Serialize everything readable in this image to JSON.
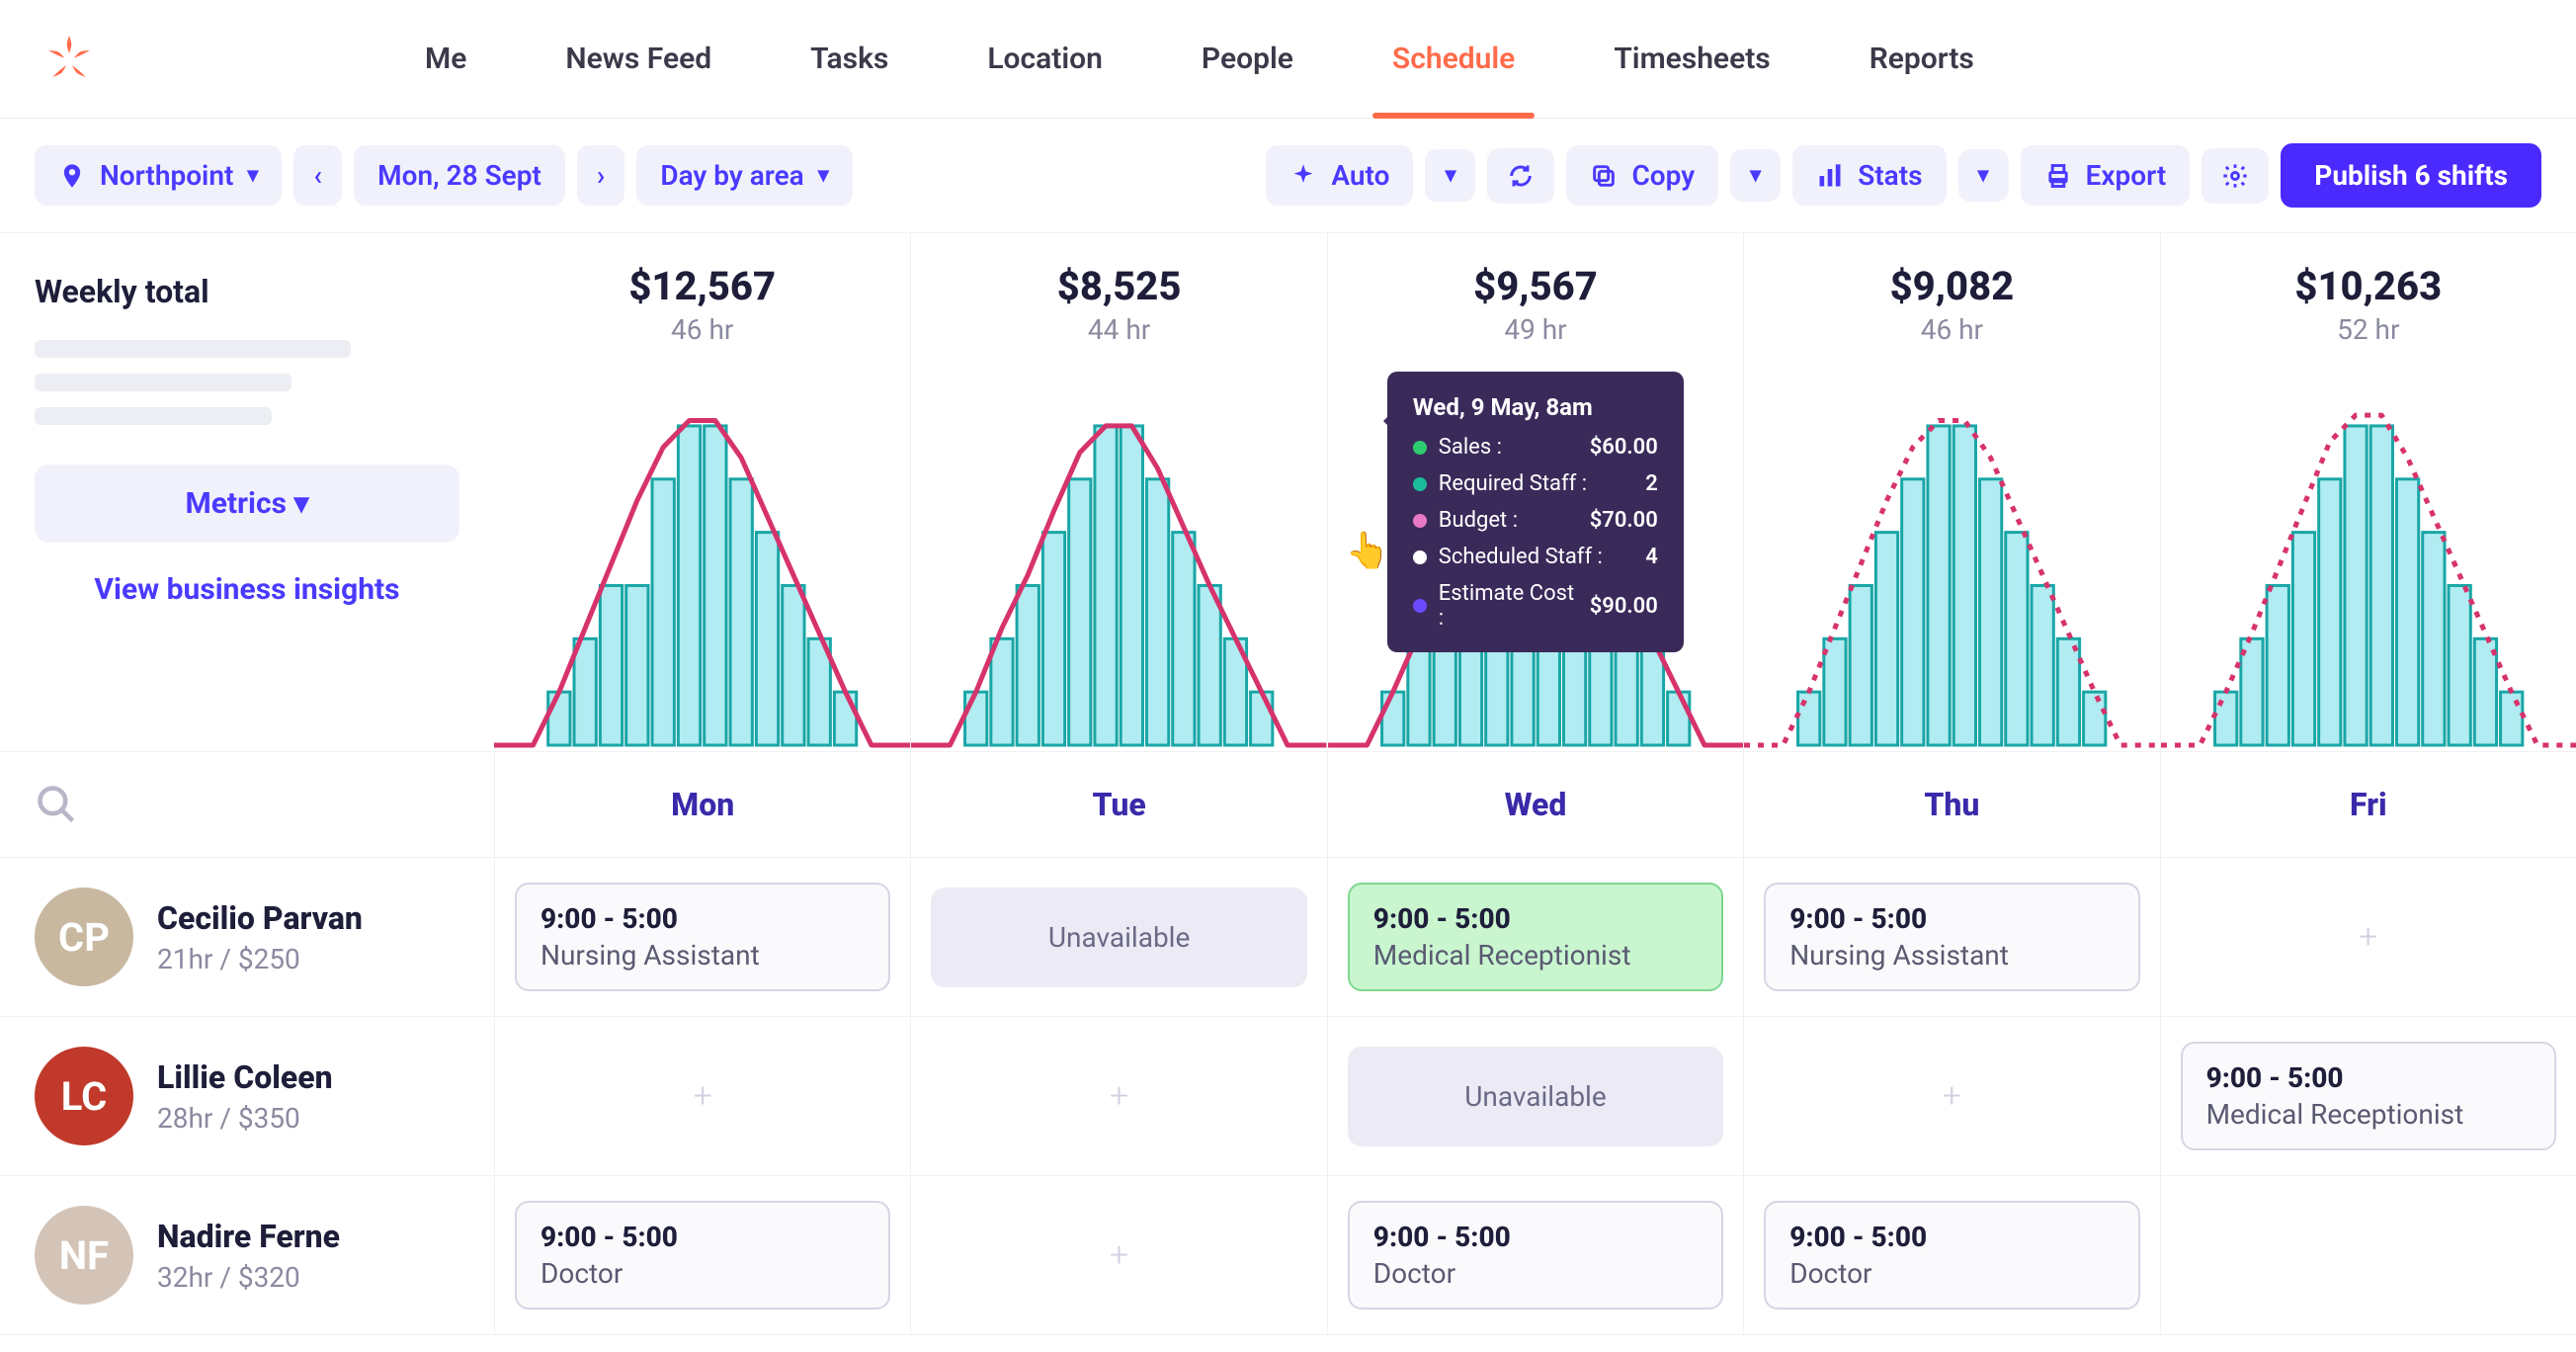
{
  "nav": {
    "items": [
      "Me",
      "News Feed",
      "Tasks",
      "Location",
      "People",
      "Schedule",
      "Timesheets",
      "Reports"
    ],
    "active": "Schedule"
  },
  "toolbar": {
    "location": "Northpoint",
    "date": "Mon, 28 Sept",
    "view": "Day by area",
    "auto": "Auto",
    "copy": "Copy",
    "stats": "Stats",
    "export": "Export",
    "publish": "Publish 6 shifts"
  },
  "summary": {
    "title": "Weekly total",
    "metrics_btn": "Metrics",
    "insights_link": "View business insights"
  },
  "chart_data": [
    {
      "day": "Mon",
      "amount": "$12,567",
      "hours": "46 hr",
      "bars": [
        0,
        0,
        1,
        2,
        3,
        3,
        5,
        6,
        6,
        5,
        4,
        3,
        2,
        1,
        0,
        0
      ],
      "line": [
        0,
        0,
        1,
        2.2,
        3.4,
        4.6,
        5.6,
        6.1,
        6.1,
        5.4,
        4.3,
        3.2,
        2.1,
        1,
        0,
        0
      ],
      "dotted": false
    },
    {
      "day": "Tue",
      "amount": "$8,525",
      "hours": "44 hr",
      "bars": [
        0,
        0,
        1,
        2,
        3,
        4,
        5,
        6,
        6,
        5,
        4,
        3,
        2,
        1,
        0,
        0
      ],
      "line": [
        0,
        0,
        1,
        2.2,
        3.2,
        4.4,
        5.5,
        6.0,
        6.0,
        5.2,
        4.1,
        3.0,
        2.0,
        1,
        0,
        0
      ],
      "dotted": false
    },
    {
      "day": "Wed",
      "amount": "$9,567",
      "hours": "49 hr",
      "bars": [
        0,
        0,
        1,
        2,
        3,
        4,
        5,
        6,
        6,
        5,
        4,
        3,
        2,
        1,
        0,
        0
      ],
      "line": [
        0,
        0,
        1,
        2.1,
        3.3,
        4.5,
        5.6,
        6.1,
        6.1,
        5.3,
        4.2,
        3.1,
        2.0,
        1,
        0,
        0
      ],
      "dotted": false
    },
    {
      "day": "Thu",
      "amount": "$9,082",
      "hours": "46 hr",
      "bars": [
        0,
        0,
        1,
        2,
        3,
        4,
        5,
        6,
        6,
        5,
        4,
        3,
        2,
        1,
        0,
        0
      ],
      "line": [
        0,
        0,
        1,
        2.2,
        3.4,
        4.6,
        5.6,
        6.1,
        6.1,
        5.4,
        4.3,
        3.2,
        2.1,
        1,
        0,
        0
      ],
      "dotted": true
    },
    {
      "day": "Fri",
      "amount": "$10,263",
      "hours": "52 hr",
      "bars": [
        0,
        0,
        1,
        2,
        3,
        4,
        5,
        6,
        6,
        5,
        4,
        3,
        2,
        1,
        0,
        0
      ],
      "line": [
        0,
        0,
        1,
        2.1,
        3.3,
        4.5,
        5.7,
        6.2,
        6.2,
        5.4,
        4.3,
        3.2,
        2.1,
        1,
        0,
        0
      ],
      "dotted": true
    }
  ],
  "tooltip": {
    "title": "Wed, 9 May, 8am",
    "rows": [
      {
        "color": "#2ecc71",
        "label": "Sales :",
        "value": "$60.00"
      },
      {
        "color": "#1abc9c",
        "label": "Required Staff :",
        "value": "2"
      },
      {
        "color": "#e879c7",
        "label": "Budget :",
        "value": "$70.00"
      },
      {
        "color": "#ffffff",
        "label": "Scheduled Staff :",
        "value": "4"
      },
      {
        "color": "#6a4aff",
        "label": "Estimate Cost :",
        "value": "$90.00"
      }
    ]
  },
  "days": [
    "Mon",
    "Tue",
    "Wed",
    "Thu",
    "Fri"
  ],
  "staff": [
    {
      "name": "Cecilio Parvan",
      "meta": "21hr / $250",
      "avatar_bg": "#c8b8a0",
      "slots": [
        {
          "type": "shift",
          "time": "9:00 - 5:00",
          "role": "Nursing Assistant",
          "style": "gray"
        },
        {
          "type": "unavail",
          "label": "Unavailable"
        },
        {
          "type": "shift",
          "time": "9:00 - 5:00",
          "role": "Medical Receptionist",
          "style": "green"
        },
        {
          "type": "shift",
          "time": "9:00 - 5:00",
          "role": "Nursing Assistant",
          "style": "gray"
        },
        {
          "type": "add"
        }
      ]
    },
    {
      "name": "Lillie Coleen",
      "meta": "28hr / $350",
      "avatar_bg": "#c0392b",
      "slots": [
        {
          "type": "add"
        },
        {
          "type": "add"
        },
        {
          "type": "unavail",
          "label": "Unavailable"
        },
        {
          "type": "add"
        },
        {
          "type": "shift",
          "time": "9:00 - 5:00",
          "role": "Medical Receptionist",
          "style": "gray"
        }
      ]
    },
    {
      "name": "Nadire Ferne",
      "meta": "32hr / $320",
      "avatar_bg": "#d4c4b8",
      "slots": [
        {
          "type": "shift",
          "time": "9:00 - 5:00",
          "role": "Doctor",
          "style": "gray"
        },
        {
          "type": "add"
        },
        {
          "type": "shift",
          "time": "9:00 - 5:00",
          "role": "Doctor",
          "style": "gray"
        },
        {
          "type": "shift",
          "time": "9:00 - 5:00",
          "role": "Doctor",
          "style": "gray"
        },
        {
          "type": "empty"
        }
      ]
    }
  ]
}
